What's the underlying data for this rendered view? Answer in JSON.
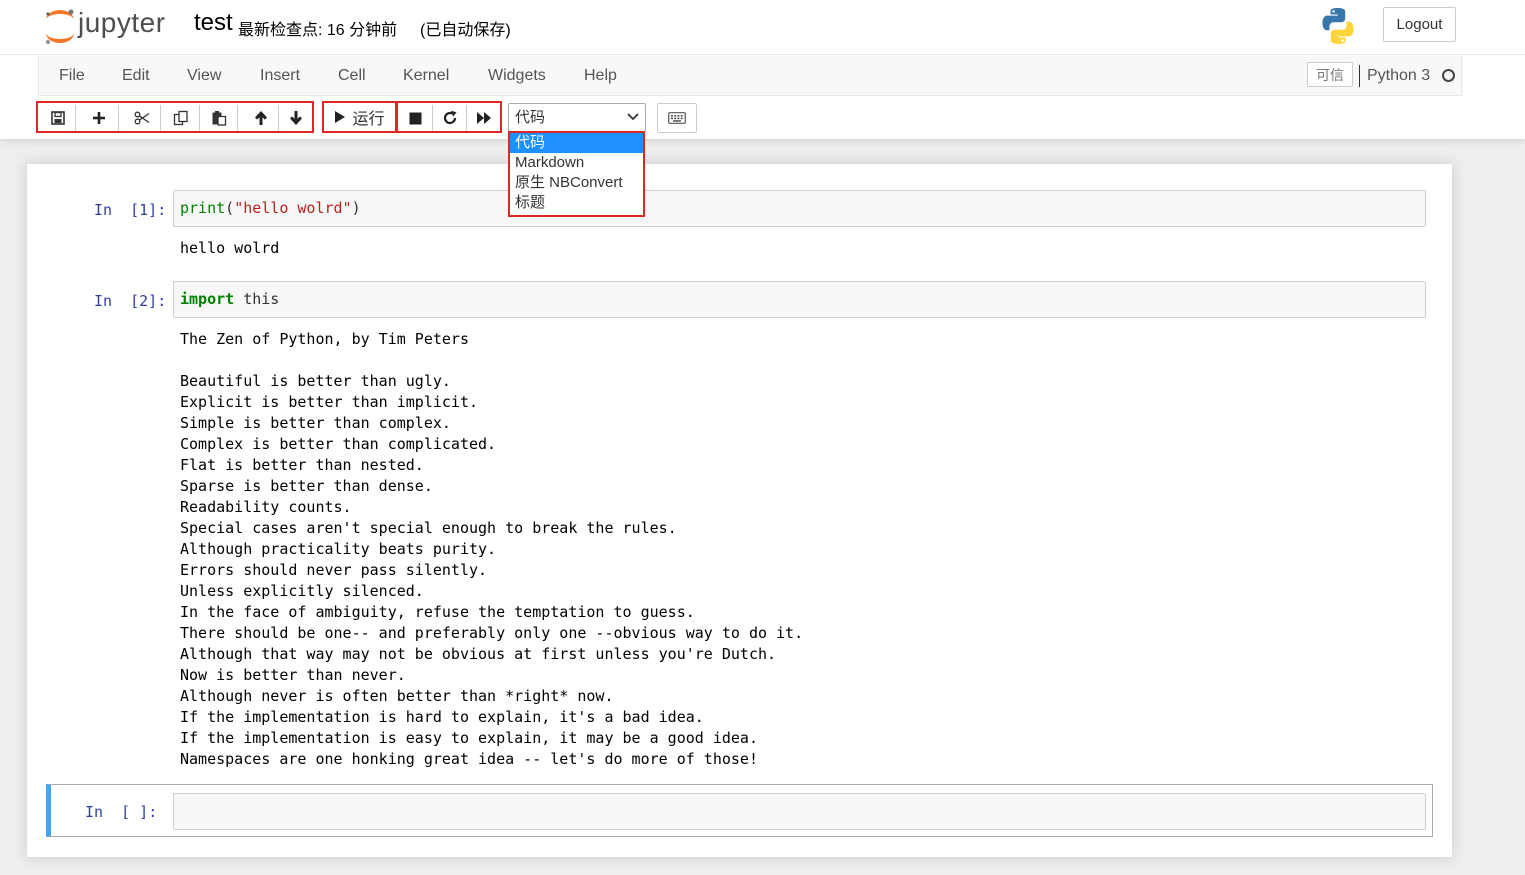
{
  "header": {
    "logo_text": "jupyter",
    "notebook_name": "test",
    "checkpoint": "最新检查点: 16 分钟前",
    "autosave": "(已自动保存)",
    "logout_label": "Logout"
  },
  "menubar": {
    "items": [
      "File",
      "Edit",
      "View",
      "Insert",
      "Cell",
      "Kernel",
      "Widgets",
      "Help"
    ],
    "trusted_label": "可信",
    "kernel_name": "Python 3"
  },
  "toolbar": {
    "run_label": "运行",
    "cell_type_selected": "代码",
    "cell_type_options": [
      "代码",
      "Markdown",
      "原生 NBConvert",
      "标题"
    ]
  },
  "cells": [
    {
      "prompt": "In  [1]:",
      "code_func": "print",
      "code_open": "(",
      "code_string": "\"hello wolrd\"",
      "code_close": ")",
      "output": "hello wolrd"
    },
    {
      "prompt": "In  [2]:",
      "code_keyword": "import",
      "code_rest": " this",
      "output": "The Zen of Python, by Tim Peters\n\nBeautiful is better than ugly.\nExplicit is better than implicit.\nSimple is better than complex.\nComplex is better than complicated.\nFlat is better than nested.\nSparse is better than dense.\nReadability counts.\nSpecial cases aren't special enough to break the rules.\nAlthough practicality beats purity.\nErrors should never pass silently.\nUnless explicitly silenced.\nIn the face of ambiguity, refuse the temptation to guess.\nThere should be one-- and preferably only one --obvious way to do it.\nAlthough that way may not be obvious at first unless you're Dutch.\nNow is better than never.\nAlthough never is often better than *right* now.\nIf the implementation is hard to explain, it's a bad idea.\nIf the implementation is easy to explain, it may be a good idea.\nNamespaces are one honking great idea -- let's do more of those!"
    },
    {
      "prompt": "In  [ ]:"
    }
  ],
  "colors": {
    "highlight_border": "#e02525",
    "prompt_in": "#303f9f",
    "keyword": "#008000",
    "string": "#ba2121",
    "active_cell_bar": "#42a5f5",
    "dropdown_selected": "#1e90ff"
  }
}
